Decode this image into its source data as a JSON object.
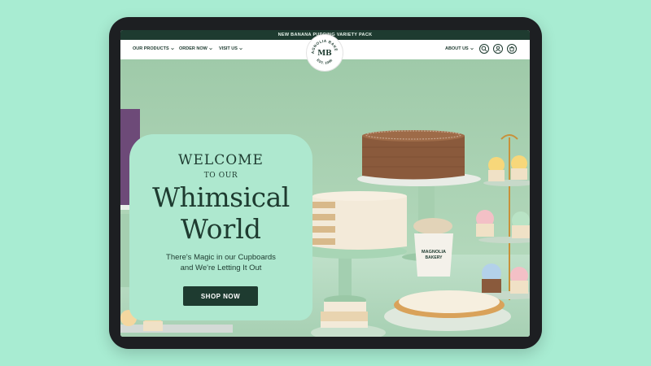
{
  "announcement": "NEW BANANA PUDDING VARIETY PACK",
  "nav": {
    "our_products": "OUR PRODUCTS",
    "order_now": "ORDER NOW",
    "visit_us": "VISIT US",
    "about_us": "ABOUT US"
  },
  "logo": {
    "top_text": "MAGNOLIA BAKERY",
    "bottom_text": "EST. 1996",
    "monogram": "MB"
  },
  "hero": {
    "welcome": "WELCOME",
    "to_our": "TO OUR",
    "line1": "Whimsical",
    "line2": "World",
    "subtitle_line1": "There's Magic in our Cupboards",
    "subtitle_line2": "and We're Letting It Out",
    "cta": "SHOP NOW"
  },
  "cup_label": {
    "line1": "MAGNOLIA",
    "line2": "BAKERY"
  },
  "colors": {
    "background": "#a8ecd2",
    "brand_dark": "#1e3b30",
    "card": "#aee8cf"
  },
  "icons": [
    "search-icon",
    "account-icon",
    "cart-icon"
  ]
}
